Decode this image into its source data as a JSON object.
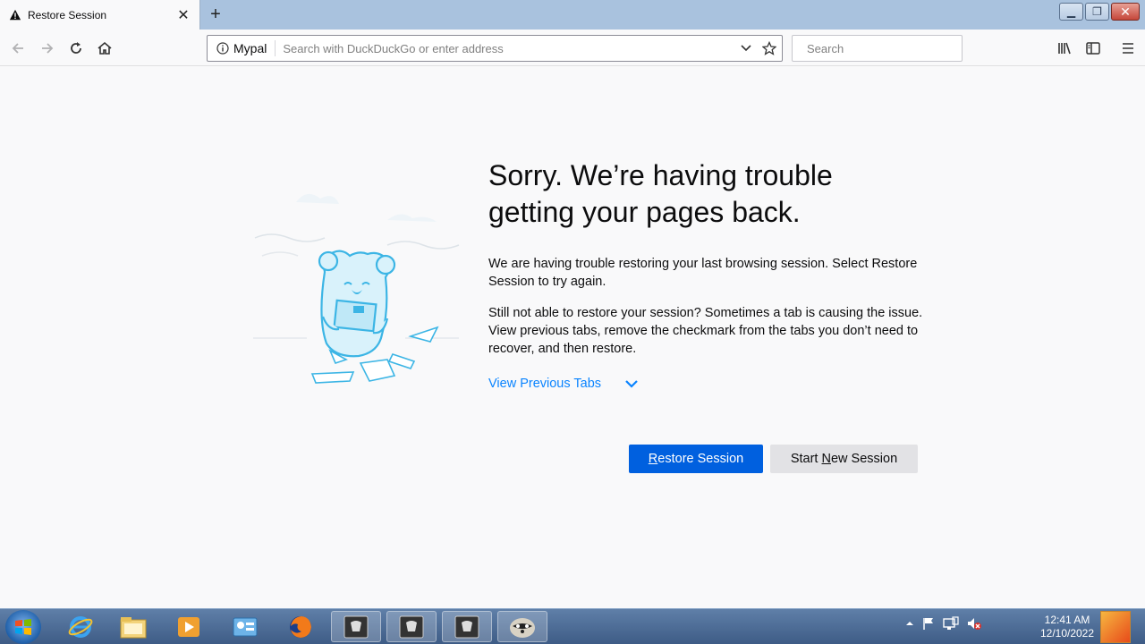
{
  "tab": {
    "title": "Restore Session",
    "icon": "warning-icon"
  },
  "urlbar": {
    "identity": "Mypal",
    "placeholder": "Search with DuckDuckGo or enter address"
  },
  "searchbar": {
    "placeholder": "Search"
  },
  "main": {
    "heading": "Sorry. We’re having trouble getting your pages back.",
    "para1": "We are having trouble restoring your last browsing session. Select Restore Session to try again.",
    "para2": "Still not able to restore your session? Sometimes a tab is causing the issue. View previous tabs, remove the checkmark from the tabs you don’t need to recover, and then restore.",
    "view_previous": "View Previous Tabs",
    "restore_prefix": "",
    "restore_underline": "R",
    "restore_rest": "estore Session",
    "new_prefix": "Start ",
    "new_underline": "N",
    "new_rest": "ew Session"
  },
  "taskbar": {
    "time": "12:41 AM",
    "date": "12/10/2022"
  },
  "colors": {
    "accent": "#0060df",
    "link": "#0a84ff",
    "titlebar": "#a9c2de"
  }
}
